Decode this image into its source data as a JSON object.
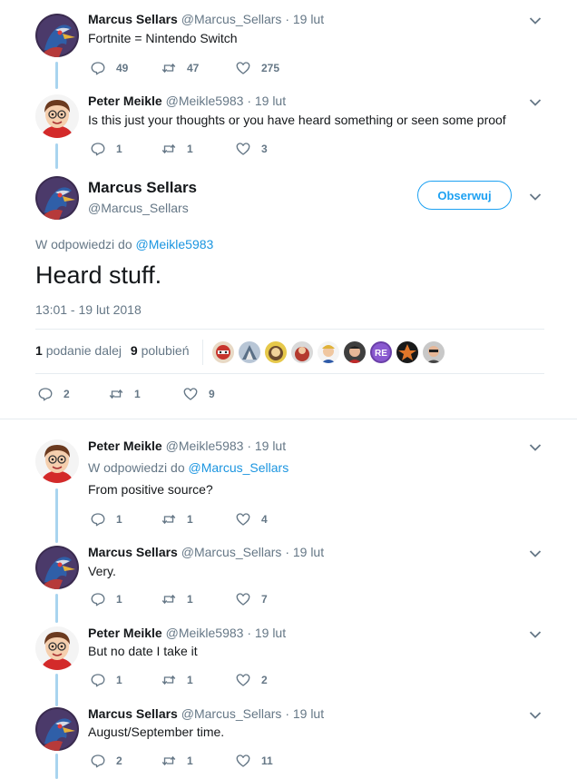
{
  "colors": {
    "accent": "#1da1f2",
    "link": "#1b95e0",
    "muted": "#657786",
    "thread": "#a9d4ef"
  },
  "tweets": [
    {
      "name": "Marcus Sellars",
      "handle": "@Marcus_Sellars",
      "date": "· 19 lut",
      "text": "Fortnite = Nintendo Switch",
      "replies": "49",
      "retweets": "47",
      "likes": "275",
      "avatar": "falco-avatar"
    },
    {
      "name": "Peter Meikle",
      "handle": "@Meikle5983",
      "date": "· 19 lut",
      "text": "Is this just your thoughts or you have heard something or seen some proof",
      "replies": "1",
      "retweets": "1",
      "likes": "3",
      "avatar": "mii-avatar"
    }
  ],
  "main": {
    "name": "Marcus Sellars",
    "handle": "@Marcus_Sellars",
    "follow_label": "Obserwuj",
    "reply_prefix": "W odpowiedzi do",
    "reply_to": "@Meikle5983",
    "text": "Heard stuff.",
    "timestamp": "13:01 - 19 lut 2018",
    "retweet_count": "1",
    "retweet_label": "podanie dalej",
    "like_count": "9",
    "like_label": "polubień",
    "replies": "2",
    "retweets": "1",
    "likes": "9"
  },
  "replies": [
    {
      "name": "Peter Meikle",
      "handle": "@Meikle5983",
      "date": "· 19 lut",
      "reply_prefix": "W odpowiedzi do",
      "reply_to": "@Marcus_Sellars",
      "text": "From positive source?",
      "replies": "1",
      "retweets": "1",
      "likes": "4"
    },
    {
      "name": "Marcus Sellars",
      "handle": "@Marcus_Sellars",
      "date": "· 19 lut",
      "text": "Very.",
      "replies": "1",
      "retweets": "1",
      "likes": "7"
    },
    {
      "name": "Peter Meikle",
      "handle": "@Meikle5983",
      "date": "· 19 lut",
      "text": "But no date I take it",
      "replies": "1",
      "retweets": "1",
      "likes": "2"
    },
    {
      "name": "Marcus Sellars",
      "handle": "@Marcus_Sellars",
      "date": "· 19 lut",
      "text": "August/September time.",
      "replies": "2",
      "retweets": "1",
      "likes": "11"
    }
  ]
}
